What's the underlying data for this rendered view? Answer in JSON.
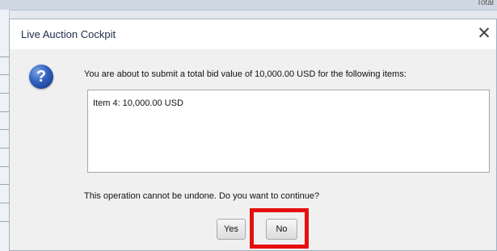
{
  "background": {
    "topbar_text": "Total"
  },
  "dialog": {
    "title": "Live Auction Cockpit",
    "close_symbol": "✕",
    "icon": "question-icon",
    "icon_glyph": "?",
    "message": "You are about to submit a total bid value of 10,000.00 USD for the following items:",
    "items": [
      {
        "text": "Item 4:  10,000.00 USD"
      }
    ],
    "confirm_text": "This operation cannot be undone. Do you want to continue?",
    "buttons": {
      "yes": "Yes",
      "no": "No"
    }
  },
  "colors": {
    "highlight": "#e4100f",
    "icon_blue": "#2f5fc0"
  }
}
